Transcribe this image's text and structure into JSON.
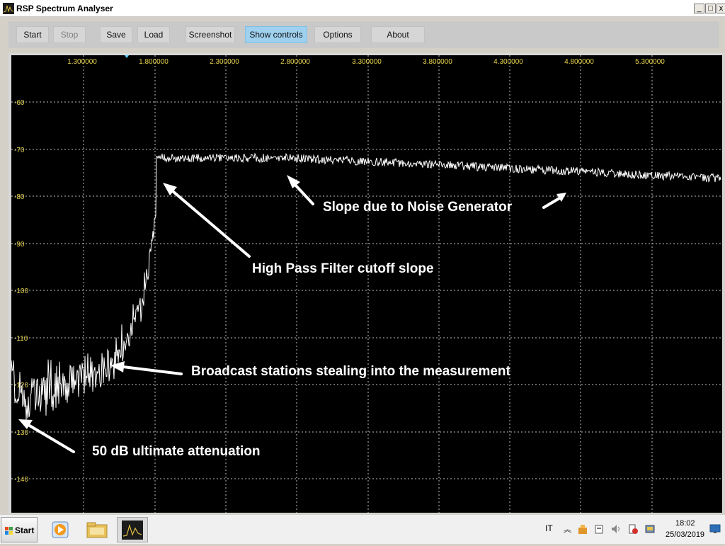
{
  "window": {
    "title": "RSP Spectrum Analyser",
    "controls": {
      "minimize": "_",
      "maximize": "□",
      "close": "x"
    }
  },
  "toolbar": {
    "buttons": [
      {
        "label": "Start",
        "state": "normal"
      },
      {
        "label": "Stop",
        "state": "disabled"
      },
      {
        "label": "Save",
        "state": "normal"
      },
      {
        "label": "Load",
        "state": "normal"
      },
      {
        "label": "Screenshot",
        "state": "normal"
      },
      {
        "label": "Show controls",
        "state": "active"
      },
      {
        "label": "Options",
        "state": "normal"
      },
      {
        "label": "About",
        "state": "normal"
      }
    ]
  },
  "plot": {
    "x_tick_labels": [
      "1.300000",
      "1.800000",
      "2.300000",
      "2.800000",
      "3.300000",
      "3.800000",
      "4.300000",
      "4.800000",
      "5.300000"
    ],
    "y_tick_labels": [
      "-60",
      "-70",
      "-80",
      "-90",
      "-100",
      "-110",
      "-120",
      "-130",
      "-140"
    ],
    "annotations": [
      "Slope due to Noise Generator",
      "High Pass Filter cutoff slope",
      "Broadcast stations stealing into the measurement",
      "50 dB ultimate attenuation"
    ],
    "colors": {
      "background": "#000000",
      "trace": "#ffffff",
      "tick_labels": "#e8d44d",
      "grid": "#bfbfbf"
    }
  },
  "taskbar": {
    "start_label": "Start",
    "language": "IT",
    "clock_time": "18:02",
    "clock_date": "25/03/2019"
  }
}
